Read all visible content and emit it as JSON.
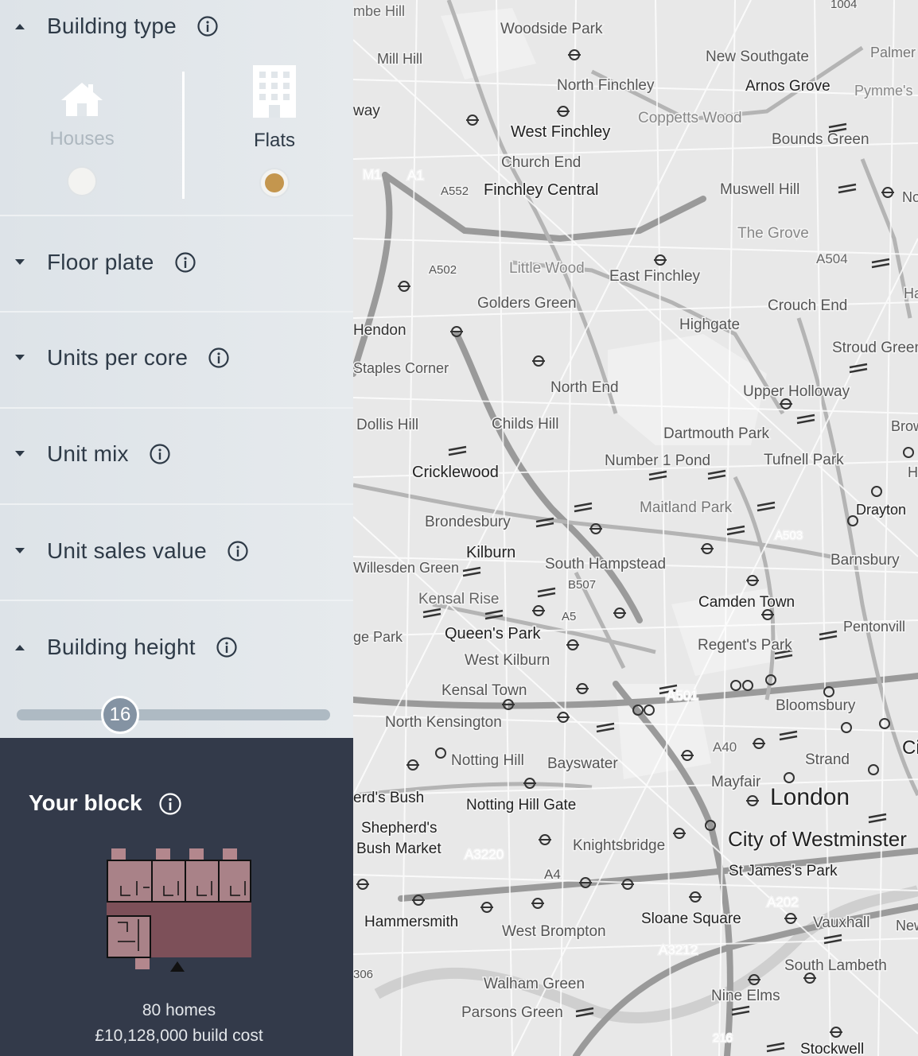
{
  "sidebar": {
    "building_type": {
      "title": "Building type",
      "options": [
        {
          "label": "Houses",
          "selected": false
        },
        {
          "label": "Flats",
          "selected": true
        }
      ]
    },
    "sections": [
      {
        "title": "Floor plate",
        "expanded": false
      },
      {
        "title": "Units per core",
        "expanded": false
      },
      {
        "title": "Unit mix",
        "expanded": false
      },
      {
        "title": "Unit sales value",
        "expanded": false
      }
    ],
    "building_height": {
      "title": "Building height",
      "value": "16",
      "level": 0.33
    }
  },
  "block": {
    "title": "Your block",
    "homes": "80 homes",
    "cost": "£10,128,000 build cost"
  },
  "colors": {
    "accent": "#c4964e",
    "panel": "#333a4a",
    "slider": "#8493a3",
    "block_floor": "#7d5059",
    "block_unit": "#a98288"
  },
  "map": {
    "place_labels": [
      "mbe Hill",
      "Woodside Park",
      "Mill Hill",
      "New Southgate",
      "Palmer",
      "North Finchley",
      "Arnos Grove",
      "Pymme's",
      "way",
      "Coppetts Wood",
      "West Finchley",
      "Bounds Green",
      "Church End",
      "Finchley Central",
      "Muswell Hill",
      "Noe",
      "The Grove",
      "A504",
      "Little Wood",
      "East Finchley",
      "Golders Green",
      "Crouch End",
      "Ha",
      "Highgate",
      "Hendon",
      "Stroud Green",
      "Staples Corner",
      "North End",
      "Upper Holloway",
      "Dollis Hill",
      "Childs Hill",
      "Dartmouth Park",
      "Brow",
      "Cricklewood",
      "Number 1 Pond",
      "Tufnell Park",
      "Hig",
      "Maitland Park",
      "Drayton",
      "Brondesbury",
      "Kilburn",
      "South Hampstead",
      "Barnsbury",
      "Willesden Green",
      "Kensal Rise",
      "Camden Town",
      "Queen's Park",
      "Regent's Park",
      "Pentonvill",
      "ge Park",
      "West Kilburn",
      "Kensal Town",
      "Bloomsbury",
      "North Kensington",
      "Cit",
      "Notting Hill",
      "Bayswater",
      "Strand",
      "Mayfair",
      "London",
      "erd's Bush",
      "Notting Hill Gate",
      "Shepherd's",
      "City of Westminster",
      "Bush Market",
      "Knightsbridge",
      "St James's Park",
      "Hammersmith",
      "Vauxhall",
      "New",
      "Sloane Square",
      "West Brompton",
      "South Lambeth",
      "Walham Green",
      "Nine Elms",
      "Parsons Green",
      "Stockwell",
      "A40",
      "A501",
      "A1",
      "A502",
      "A552",
      "M1",
      "A5",
      "B507",
      "A503",
      "A4",
      "A3220",
      "A3212",
      "A202",
      "306",
      "216",
      "1004"
    ]
  }
}
